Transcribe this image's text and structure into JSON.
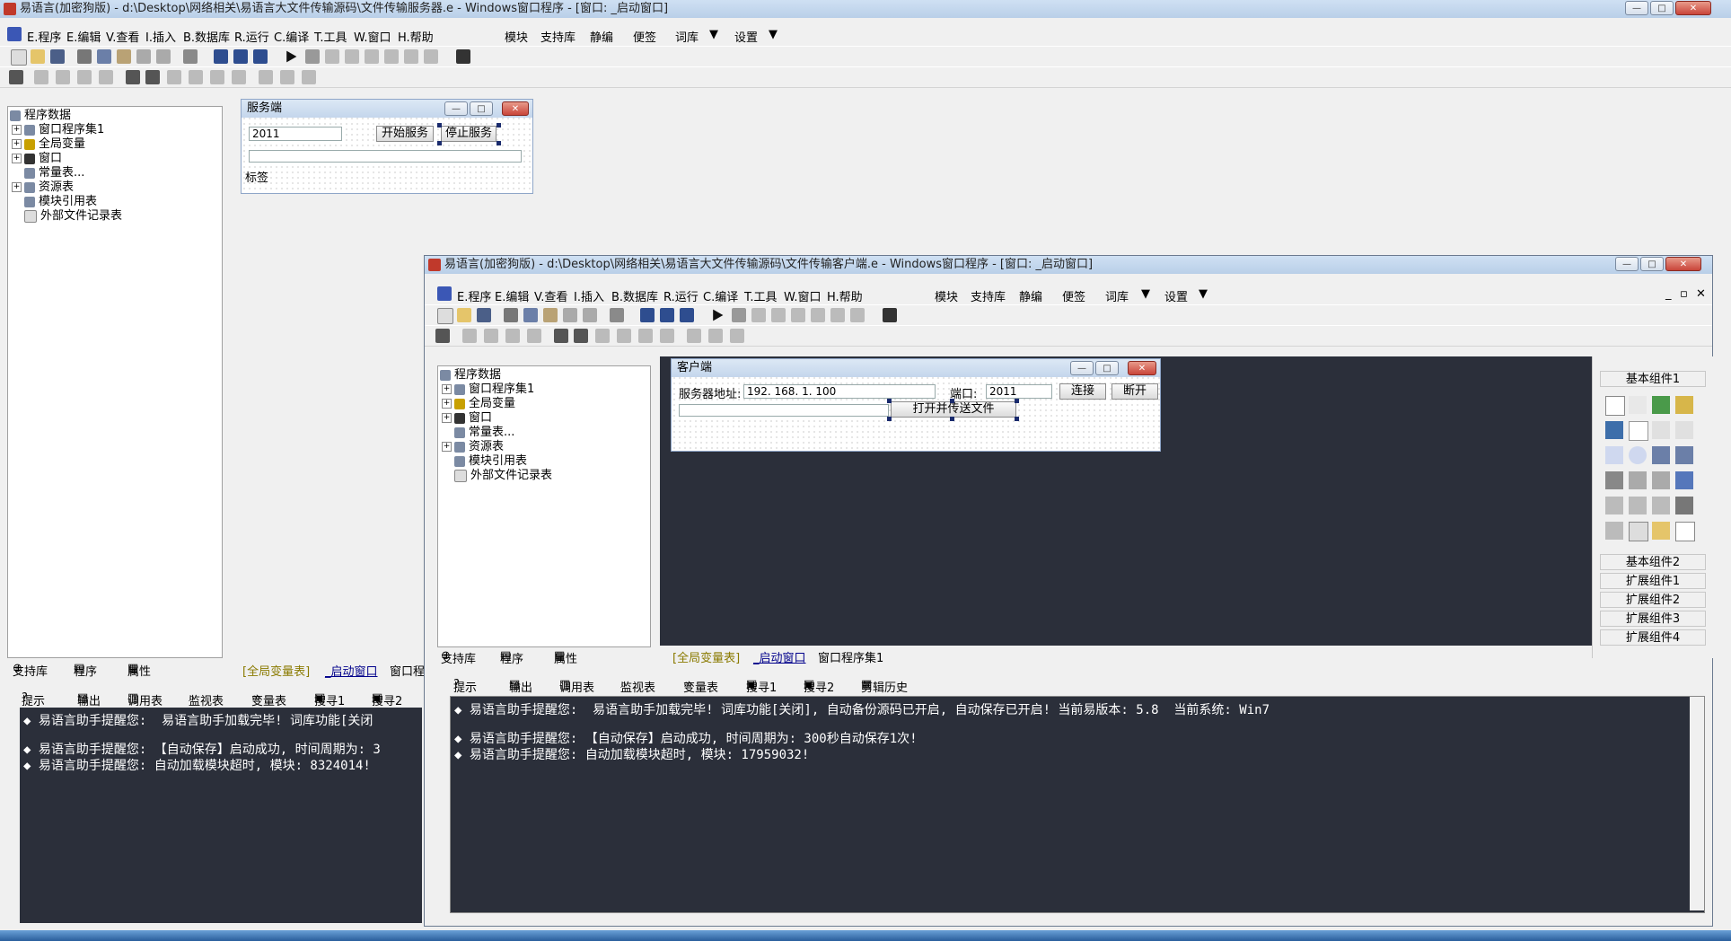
{
  "server_window": {
    "title": "易语言(加密狗版) - d:\\Desktop\\网络相关\\易语言大文件传输源码\\文件传输服务器.e - Windows窗口程序 - [窗口: _启动窗口]",
    "menu": [
      "E.程序",
      "E.编辑",
      "V.查看",
      "I.插入",
      "B.数据库",
      "R.运行",
      "C.编译",
      "T.工具",
      "W.窗口",
      "H.帮助"
    ],
    "menu_right": [
      "模块",
      "支持库",
      "静编",
      "便签",
      "词库",
      "设置"
    ],
    "tree_root": "程序数据",
    "tree_items": [
      "窗口程序集1",
      "全局变量",
      "窗口",
      "常量表...",
      "资源表",
      "模块引用表",
      "外部文件记录表"
    ],
    "bottom_tabs": [
      "支持库",
      "程序",
      "属性"
    ],
    "editor_tabs": [
      "[全局变量表]",
      "_启动窗口",
      "窗口程"
    ],
    "output_tabs": [
      "提示",
      "输出",
      "调用表",
      "监视表",
      "变量表",
      "搜寻1",
      "搜寻2"
    ],
    "output_lines": [
      "◆ 易语言助手提醒您:  易语言助手加载完毕! 词库功能[关闭",
      "◆ 易语言助手提醒您: 【自动保存】启动成功, 时间周期为: 3",
      "◆ 易语言助手提醒您: 自动加载模块超时, 模块: 8324014!"
    ],
    "form": {
      "title": "服务端",
      "port_value": "2011",
      "start_button": "开始服务",
      "stop_button": "停止服务",
      "label": "标签"
    }
  },
  "client_window": {
    "title": "易语言(加密狗版) - d:\\Desktop\\网络相关\\易语言大文件传输源码\\文件传输客户端.e - Windows窗口程序 - [窗口: _启动窗口]",
    "menu": [
      "E.程序",
      "E.编辑",
      "V.查看",
      "I.插入",
      "B.数据库",
      "R.运行",
      "C.编译",
      "T.工具",
      "W.窗口",
      "H.帮助"
    ],
    "menu_right": [
      "模块",
      "支持库",
      "静编",
      "便签",
      "词库",
      "设置"
    ],
    "tree_root": "程序数据",
    "tree_items": [
      "窗口程序集1",
      "全局变量",
      "窗口",
      "常量表...",
      "资源表",
      "模块引用表",
      "外部文件记录表"
    ],
    "bottom_tabs": [
      "支持库",
      "程序",
      "属性"
    ],
    "editor_tabs": [
      "[全局变量表]",
      "_启动窗口",
      "窗口程序集1"
    ],
    "output_tabs": [
      "提示",
      "输出",
      "调用表",
      "监视表",
      "变量表",
      "搜寻1",
      "搜寻2",
      "剪辑历史"
    ],
    "output_lines": [
      "◆ 易语言助手提醒您:  易语言助手加载完毕! 词库功能[关闭], 自动备份源码已开启, 自动保存已开启! 当前易版本: 5.8  当前系统: Win7",
      "",
      "◆ 易语言助手提醒您: 【自动保存】启动成功, 时间周期为: 300秒自动保存1次!",
      "◆ 易语言助手提醒您: 自动加载模块超时, 模块: 17959032!"
    ],
    "form": {
      "title": "客户端",
      "server_label": "服务器地址:",
      "server_value": "192. 168. 1. 100",
      "port_label": "端口:",
      "port_value": "2011",
      "connect_button": "连接",
      "disconnect_button": "断开",
      "send_button": "打开并传送文件"
    },
    "toolbox": {
      "header": "基本组件",
      "header1": "基本组件1",
      "groups": [
        "基本组件2",
        "扩展组件1",
        "扩展组件2",
        "扩展组件3",
        "扩展组件4"
      ]
    }
  },
  "colors": {
    "desktop": "#2b2f3a",
    "accent_close": "#c9453a",
    "title_bg": "#c4d6ec"
  }
}
